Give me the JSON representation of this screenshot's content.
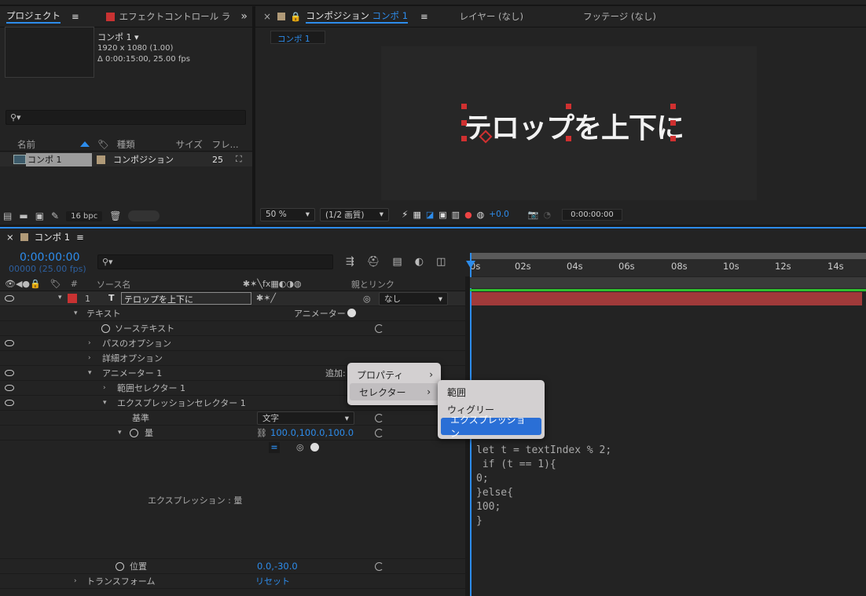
{
  "project_panel": {
    "tabs": [
      {
        "label": "プロジェクト",
        "menu": "≡"
      },
      {
        "label": "エフェクトコントロール ラ"
      }
    ],
    "expand": "»",
    "comp_name": "コンポ 1 ▾",
    "comp_res": "1920 x 1080 (1.00)",
    "comp_dur": "Δ 0:00:15:00, 25.00 fps",
    "search_icon": "⚲▾",
    "columns": [
      "名前",
      "種類",
      "サイズ",
      "フレ..."
    ],
    "items": [
      {
        "name": "コンポ 1",
        "type": "コンポジション",
        "fps": "25"
      }
    ],
    "bpc": "16 bpc"
  },
  "viewer": {
    "tab_close": "×",
    "tab_label": "コンポジション",
    "tab_comp": "コンポ 1",
    "tab_menu": "≡",
    "layer_tab": "レイヤー (なし)",
    "footage_tab": "フッテージ (なし)",
    "breadcrumb": "コンポ 1",
    "canvas_text": "テロップを上下に",
    "zoom": "50 %",
    "quality": "(1/2 画質)",
    "exposure": "+0.0",
    "timecode": "0:00:00:00"
  },
  "timeline": {
    "close": "×",
    "comp_tab": "コンポ 1",
    "menu": "≡",
    "time": "0:00:00:00",
    "frames": "00000 (25.00 fps)",
    "search_icon": "⚲▾",
    "col_num": "#",
    "col_source": "ソース名",
    "col_parent": "親とリンク",
    "ruler": [
      "0s",
      "02s",
      "04s",
      "06s",
      "08s",
      "10s",
      "12s",
      "14s"
    ],
    "layer": {
      "num": "1",
      "type": "T",
      "name": "テロップを上下に",
      "parent": "なし"
    },
    "rows": {
      "text": "テキスト",
      "animator_label": "アニメーター :",
      "source_text": "ソーステキスト",
      "path_options": "パスのオプション",
      "more_options": "詳細オプション",
      "animator1": "アニメーター 1",
      "add_label": "追加:",
      "range_selector": "範囲セレクター 1",
      "expr_selector": "エクスプレッションセレクター 1",
      "basis": "基準",
      "basis_value": "文字",
      "amount": "量",
      "amount_value": "100.0,100.0,100.0",
      "eq": "=",
      "expr_label": "エクスプレッション : 量",
      "position": "位置",
      "position_value": "0.0,-30.0",
      "transform": "トランスフォーム",
      "reset": "リセット"
    },
    "expression_code": "let t = textIndex % 2;\n if (t == 1){\n0;\n}else{\n100;\n}"
  },
  "menus": {
    "main": [
      {
        "label": "プロパティ",
        "arrow": "›"
      },
      {
        "label": "セレクター",
        "arrow": "›"
      }
    ],
    "sub": [
      "範囲",
      "ウィグリー",
      "エクスプレッション"
    ]
  },
  "colors": {
    "accent": "#2d8ceb",
    "layer_label": "#c83232",
    "bar": "#a03a3a",
    "green": "#2fbf2f"
  }
}
